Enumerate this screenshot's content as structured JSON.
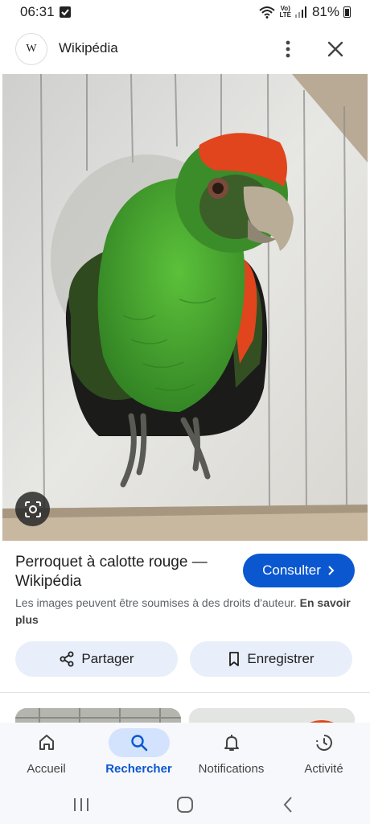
{
  "status_bar": {
    "time": "06:31",
    "network_label": "Vo)\nLTE",
    "battery": "81%"
  },
  "header": {
    "site_logo_letter": "W",
    "site_title": "Wikipédia"
  },
  "result": {
    "title": "Perroquet à calotte rouge — Wikipédia",
    "visit_label": "Consulter",
    "copyright_notice": "Les images peuvent être soumises à des droits d'auteur.",
    "learn_more": "En savoir plus"
  },
  "actions": {
    "share_label": "Partager",
    "save_label": "Enregistrer"
  },
  "bottom_nav": {
    "items": [
      {
        "label": "Accueil",
        "icon": "home-icon",
        "active": false
      },
      {
        "label": "Rechercher",
        "icon": "search-icon",
        "active": true
      },
      {
        "label": "Notifications",
        "icon": "bell-icon",
        "active": false
      },
      {
        "label": "Activité",
        "icon": "activity-icon",
        "active": false
      }
    ]
  },
  "colors": {
    "accent": "#0b57d0",
    "active_pill": "#d3e3fd",
    "action_pill": "#e8eefa",
    "parrot_green": "#3e9a2c",
    "parrot_red": "#e0451d"
  }
}
